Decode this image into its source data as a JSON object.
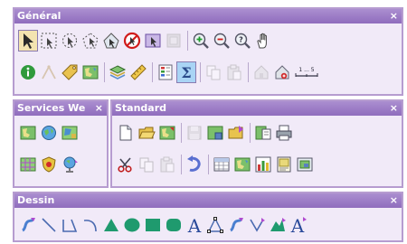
{
  "general": {
    "title": "Général",
    "close": "×",
    "row1": [
      "select-arrow-icon",
      "select-box-icon",
      "select-circle-icon",
      "select-polygon-icon",
      "select-shape-icon",
      "clear-selection-icon",
      "select-by-attribute-icon",
      "select-layer-icon",
      "zoom-in-icon",
      "zoom-out-icon",
      "zoom-identify-icon",
      "pan-hand-icon"
    ],
    "row2": [
      "info-icon",
      "measure-icon",
      "tag-icon",
      "map-icon",
      "layers-icon",
      "ruler-icon",
      "legend-icon",
      "sum-icon",
      "copy-icon",
      "paste-icon",
      "home-icon",
      "export-icon"
    ],
    "scale_label": "1 ... 5"
  },
  "services": {
    "title": "Services We",
    "close": "×"
  },
  "standard": {
    "title": "Standard",
    "close": "×"
  },
  "dessin": {
    "title": "Dessin",
    "close": "×"
  }
}
